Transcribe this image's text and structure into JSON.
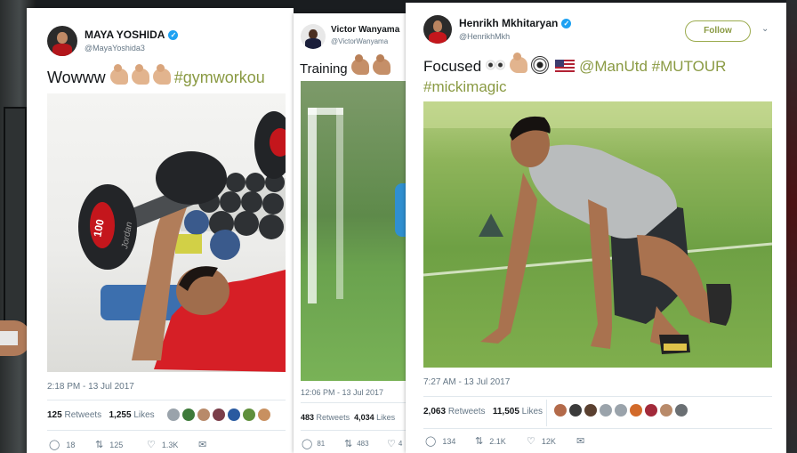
{
  "cards": [
    {
      "name": "MAYA YOSHIDA",
      "handle": "@MayaYoshida3",
      "text_lead": "Wowww",
      "hashtag": "#gymworkou",
      "timestamp": "2:18 PM - 13 Jul 2017",
      "retweets_count": "125",
      "retweets_label": "Retweets",
      "likes_count": "1,255",
      "likes_label": "Likes",
      "replies": "18",
      "rts": "125",
      "likes_short": "1.3K",
      "dumbbell_label": "100",
      "dumbbell_brand": "Jordan"
    },
    {
      "name": "Victor Wanyama",
      "handle": "@VictorWanyama",
      "text_lead": "Training",
      "timestamp": "12:06 PM - 13 Jul 2017",
      "retweets_count": "483",
      "retweets_label": "Retweets",
      "likes_count": "4,034",
      "likes_label": "Likes",
      "replies": "81",
      "rts": "483",
      "likes_short": "4"
    },
    {
      "name": "Henrikh Mkhitaryan",
      "handle": "@HenrikhMkh",
      "follow_label": "Follow",
      "text_lead": "Focused",
      "mention": "@ManUtd",
      "hashtag1": "#MUTOUR",
      "hashtag2": "#mickimagic",
      "timestamp": "7:27 AM - 13 Jul 2017",
      "retweets_count": "2,063",
      "retweets_label": "Retweets",
      "likes_count": "11,505",
      "likes_label": "Likes",
      "replies": "134",
      "rts": "2.1K",
      "likes_short": "12K"
    }
  ],
  "icons": {
    "verified": "verified-badge-icon",
    "reply": "reply-icon",
    "retweet": "retweet-icon",
    "like": "heart-icon",
    "message": "direct-message-icon",
    "chevron": "chevron-down-icon"
  },
  "colors": {
    "accent": "#8a9a43",
    "verified": "#1da1f2",
    "text": "#14171a",
    "muted": "#657786",
    "divider": "#e1e8ed"
  }
}
